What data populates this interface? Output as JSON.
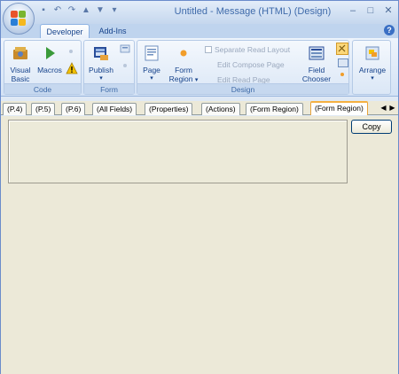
{
  "window": {
    "title": "Untitled - Message (HTML)  (Design)",
    "controls": [
      "minimize",
      "maximize",
      "close"
    ]
  },
  "quick_access": [
    "save-icon",
    "undo-icon",
    "redo-icon",
    "up-arrow-icon",
    "down-arrow-icon",
    "customize-icon"
  ],
  "ribbon_tabs": [
    "Developer",
    "Add-Ins"
  ],
  "active_ribbon_tab": "Developer",
  "groups": {
    "code": {
      "label": "Code",
      "visual_basic": "Visual Basic",
      "macros": "Macros"
    },
    "form": {
      "label": "Form",
      "publish": "Publish"
    },
    "design": {
      "label": "Design",
      "page": "Page",
      "form_region": "Form Region",
      "separate_read_layout": "Separate Read Layout",
      "edit_compose_page": "Edit Compose Page",
      "edit_read_page": "Edit Read Page",
      "field_chooser": "Field Chooser"
    },
    "arrange": {
      "label": "Arrange"
    }
  },
  "form_tabs": [
    "(P.4)",
    "(P.5)",
    "(P.6)",
    "(All Fields)",
    "(Properties)",
    "(Actions)",
    "(Form Region)",
    "(Form Region)"
  ],
  "active_form_tab": 7,
  "copy_button": "Copy",
  "colors": {
    "ribbon_bg": "#dfe9f5",
    "ribbon_text": "#15428b",
    "form_bg": "#ece9d8",
    "active_tab_accent": "#f5b041"
  }
}
